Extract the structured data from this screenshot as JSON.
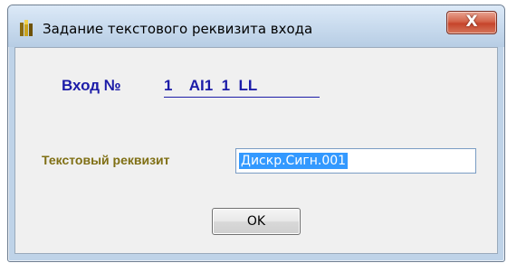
{
  "window": {
    "title": "Задание текстового реквизита входа",
    "close_label": "X"
  },
  "form": {
    "input_label": "Вход №",
    "input_value": "1    AI1  1  LL",
    "attribute_label": "Текстовый реквизит",
    "attribute_value": "Дискр.Сигн.001"
  },
  "buttons": {
    "ok_label": "OK"
  },
  "colors": {
    "input_label": "#1c1ca8",
    "attribute_label": "#7f6f14",
    "selection": "#3399ff",
    "close_button": "#c6442b"
  },
  "icons": {
    "title": "app-icon",
    "close": "close-icon"
  }
}
